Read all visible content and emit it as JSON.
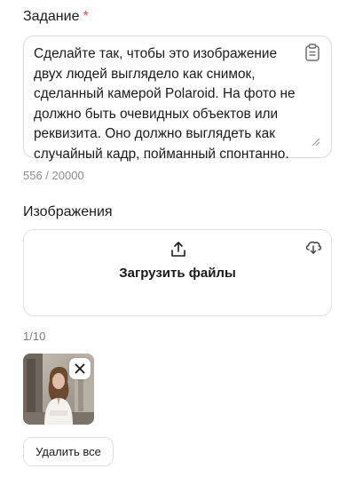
{
  "task": {
    "label": "Задание",
    "required_mark": "*",
    "prompt_text": "Сделайте так, чтобы это изображение\nдвух людей выглядело как снимок,\nсделанный камерой Polaroid. На фото не\nдолжно быть очевидных объектов или\nреквизита. Оно должно выглядеть как\nслучайный кадр, пойманный спонтанно.",
    "char_count": "556 / 20000"
  },
  "images": {
    "label": "Изображения",
    "upload_label": "Загрузить файлы",
    "count": "1/10",
    "delete_all_label": "Удалить все"
  },
  "icons": {
    "task_action": "clipboard-icon",
    "resize": "resize-handle-icon",
    "upload": "upload-icon",
    "cloud": "cloud-download-icon",
    "remove": "close-icon"
  },
  "colors": {
    "required": "#e5484d",
    "border": "#d9d9de",
    "muted_text": "#8a8a90"
  }
}
